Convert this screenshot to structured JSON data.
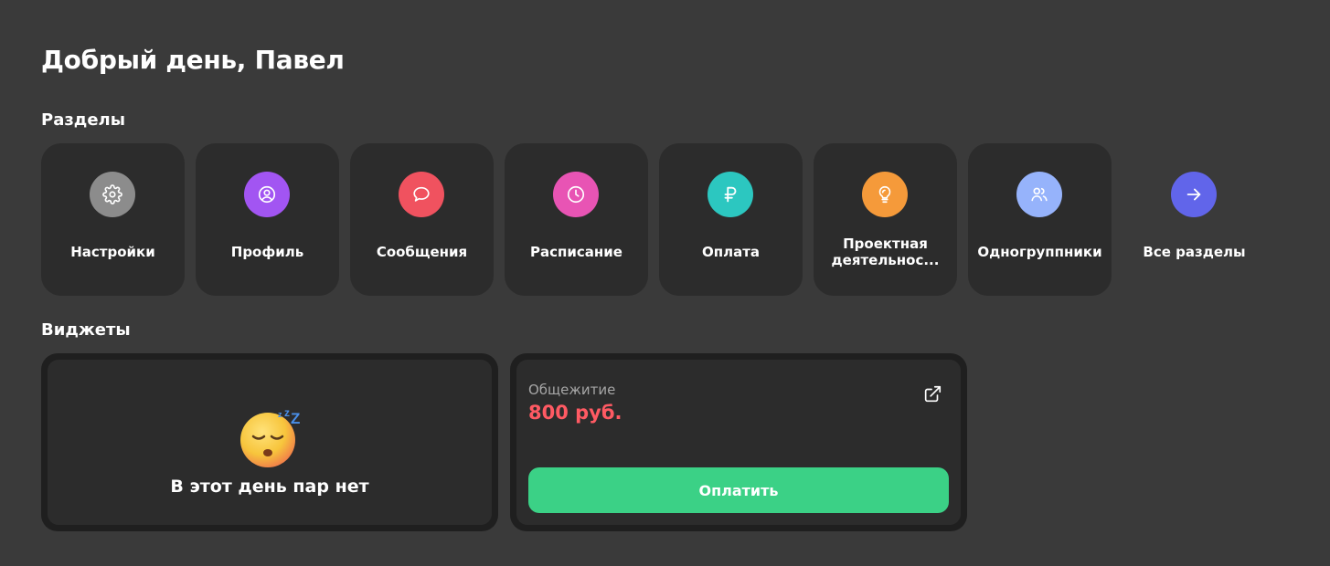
{
  "greeting": "Добрый день, Павел",
  "sections": {
    "title": "Разделы",
    "items": [
      {
        "label": "Настройки",
        "icon": "gear-icon",
        "color": "#8c8c8c"
      },
      {
        "label": "Профиль",
        "icon": "user-circle-icon",
        "color": "#a255f2"
      },
      {
        "label": "Сообщения",
        "icon": "chat-bubble-icon",
        "color": "#f0525f"
      },
      {
        "label": "Расписание",
        "icon": "clock-icon",
        "color": "#e854b4"
      },
      {
        "label": "Оплата",
        "icon": "ruble-icon",
        "color": "#2cc7c0"
      },
      {
        "label": "Проектная деятельнос...",
        "icon": "lightbulb-icon",
        "color": "#f59a3a"
      },
      {
        "label": "Одногруппники",
        "icon": "users-icon",
        "color": "#96b3fb"
      },
      {
        "label": "Все разделы",
        "icon": "arrow-right-icon",
        "color": "#6165ea"
      }
    ]
  },
  "widgets": {
    "title": "Виджеты",
    "schedule": {
      "empty_text": "В этот день пар нет",
      "emoji": "sleeping-face-icon"
    },
    "dorm": {
      "label": "Общежитие",
      "amount": "800 руб.",
      "amount_color": "#ff5a63",
      "pay_label": "Оплатить",
      "pay_color": "#3bd186",
      "link_icon": "external-link-icon"
    }
  }
}
